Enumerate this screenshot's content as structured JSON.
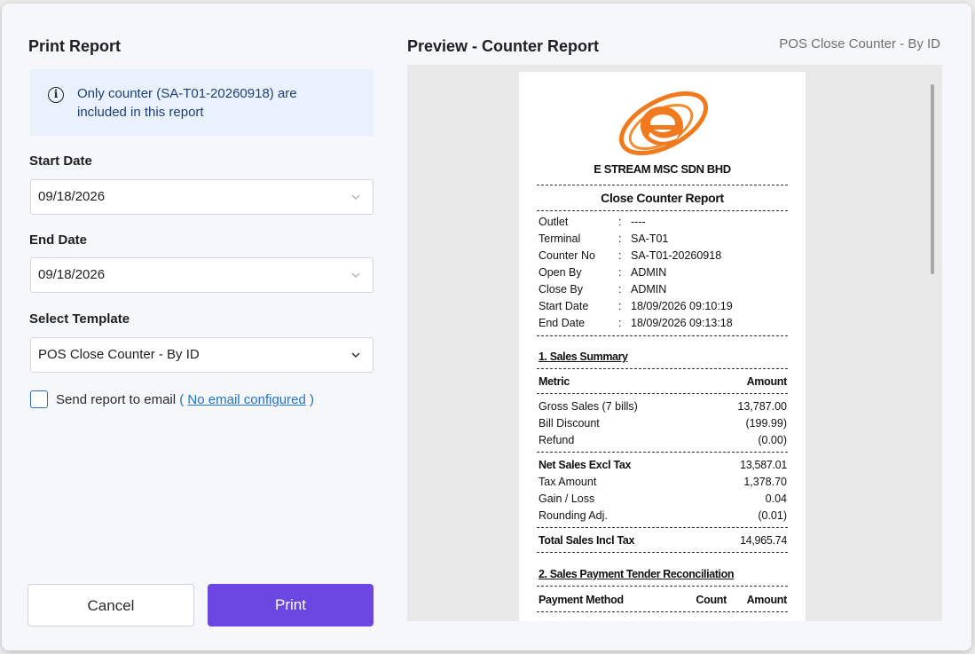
{
  "dialog": {
    "title": "Print Report",
    "info": {
      "icon": "info-icon",
      "text": "Only counter (SA-T01-20260918) are included in this report"
    },
    "start_date": {
      "label": "Start Date",
      "value": "09/18/2026"
    },
    "end_date": {
      "label": "End Date",
      "value": "09/18/2026"
    },
    "template": {
      "label": "Select Template",
      "value": "POS Close Counter - By ID"
    },
    "email": {
      "label": "Send report to email",
      "open_paren": "(",
      "link": "No email configured",
      "close_paren": ")",
      "checked": false
    },
    "buttons": {
      "cancel": "Cancel",
      "print": "Print"
    },
    "colors": {
      "accent": "#6b46e0",
      "info_bg": "#e8f1fc",
      "link": "#1e73d2"
    }
  },
  "preview": {
    "title": "Preview - Counter Report",
    "template_name": "POS Close Counter - By ID",
    "receipt": {
      "company": "E STREAM MSC SDN BHD",
      "report_title": "Close Counter Report",
      "header": [
        {
          "key": "Outlet",
          "sep": ":",
          "value": "----"
        },
        {
          "key": "Terminal",
          "sep": ":",
          "value": "SA-T01"
        },
        {
          "key": "Counter No",
          "sep": ":",
          "value": "SA-T01-20260918"
        },
        {
          "key": "Open By",
          "sep": ":",
          "value": "ADMIN"
        },
        {
          "key": "Close By",
          "sep": ":",
          "value": "ADMIN"
        },
        {
          "key": "Start Date",
          "sep": ":",
          "value": "18/09/2026 09:10:19"
        },
        {
          "key": "End Date",
          "sep": ":",
          "value": "18/09/2026 09:13:18"
        }
      ],
      "section1": {
        "title": "1. Sales Summary",
        "col_metric": "Metric",
        "col_amount": "Amount",
        "rows_a": [
          {
            "label": "Gross Sales (7 bills)",
            "amount": "13,787.00"
          },
          {
            "label": "Bill Discount",
            "amount": "(199.99)"
          },
          {
            "label": "Refund",
            "amount": "(0.00)"
          }
        ],
        "net": {
          "label": "Net Sales Excl Tax",
          "amount": "13,587.01"
        },
        "rows_b": [
          {
            "label": "Tax Amount",
            "amount": "1,378.70"
          },
          {
            "label": "Gain / Loss",
            "amount": "0.04"
          },
          {
            "label": "Rounding Adj.",
            "amount": "(0.01)"
          }
        ],
        "total": {
          "label": "Total Sales Incl Tax",
          "amount": "14,965.74"
        }
      },
      "section2": {
        "title": "2. Sales Payment Tender Reconciliation",
        "col_method": "Payment Method",
        "col_count": "Count",
        "col_amount": "Amount"
      }
    }
  }
}
